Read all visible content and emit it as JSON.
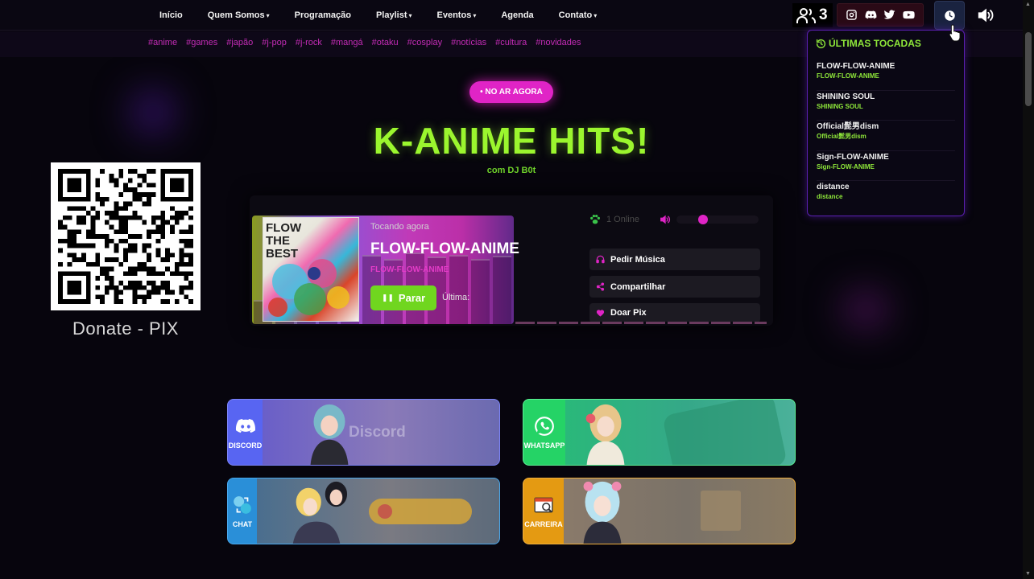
{
  "nav": {
    "items": [
      {
        "label": "Início",
        "caret": false
      },
      {
        "label": "Quem Somos",
        "caret": true
      },
      {
        "label": "Programação",
        "caret": false
      },
      {
        "label": "Playlist",
        "caret": true
      },
      {
        "label": "Eventos",
        "caret": true
      },
      {
        "label": "Agenda",
        "caret": false
      },
      {
        "label": "Contato",
        "caret": true
      }
    ],
    "listener_count": "3"
  },
  "tags": [
    "#anime",
    "#games",
    "#japão",
    "#j-pop",
    "#j-rock",
    "#mangá",
    "#otaku",
    "#cosplay",
    "#notícias",
    "#cultura",
    "#novidades"
  ],
  "live_badge": "• NO AR AGORA",
  "show": {
    "title": "K-ANIME HITS!",
    "dj": "com DJ B0t"
  },
  "donate": {
    "label": "Donate - PIX"
  },
  "player": {
    "album_text": "FLOW\nTHE\nBEST",
    "now_playing_label": "Tocando agora",
    "track_title": "FLOW-FLOW-ANIME",
    "track_artist": "FLOW-FLOW-ANIME",
    "stop_label": "Parar",
    "last_label": "Última:",
    "online_label": "1 Online",
    "volume": 0.3,
    "buttons": [
      "Pedir Música",
      "Compartilhar",
      "Doar Pix"
    ]
  },
  "history": {
    "title": "ÚLTIMAS TOCADAS",
    "items": [
      {
        "title": "FLOW-FLOW-ANIME",
        "artist": "FLOW-FLOW-ANIME"
      },
      {
        "title": "SHINING SOUL",
        "artist": "SHINING SOUL"
      },
      {
        "title": "Official髭男dism",
        "artist": "Official髭男dism"
      },
      {
        "title": "Sign-FLOW-ANIME",
        "artist": "Sign-FLOW-ANIME"
      },
      {
        "title": "distance",
        "artist": "distance"
      }
    ]
  },
  "cards": [
    {
      "label": "DISCORD",
      "word": "Discord",
      "color": "#5865f2"
    },
    {
      "label": "WHATSAPP",
      "word": "",
      "color": "#25d366"
    },
    {
      "label": "CHAT",
      "word": "",
      "color": "#2a8fd8"
    },
    {
      "label": "CARREIRA",
      "word": "",
      "color": "#e49a12"
    }
  ],
  "colors": {
    "accent_green": "#9bf62e",
    "accent_pink": "#e024c6",
    "accent_purple": "#5a1fb0"
  },
  "icons": [
    "users-icon",
    "instagram-icon",
    "discord-icon",
    "twitter-icon",
    "youtube-icon",
    "clock-icon",
    "volume-icon",
    "history-icon",
    "paw-icon",
    "headphones-icon",
    "share-icon",
    "heart-icon",
    "pause-icon",
    "whatsapp-icon",
    "chat-icon",
    "briefcase-icon"
  ]
}
